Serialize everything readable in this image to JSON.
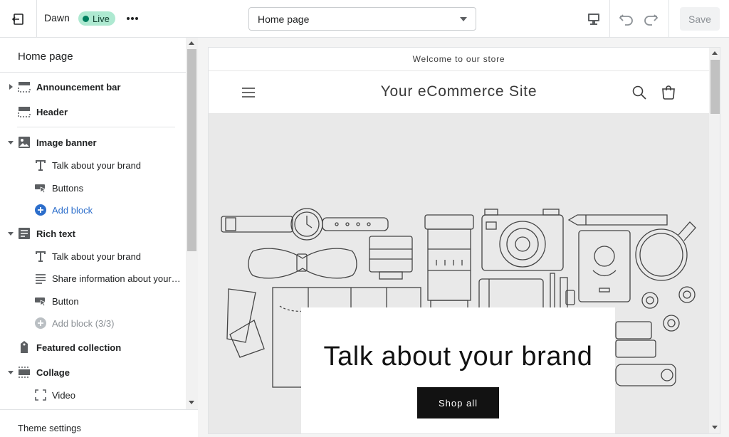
{
  "topbar": {
    "exit_icon": "exit-icon",
    "theme_name": "Dawn",
    "live_badge": "Live",
    "more_icon": "more-horizontal-icon",
    "page_select": "Home page",
    "device_icon": "desktop-icon",
    "undo_icon": "undo-icon",
    "redo_icon": "redo-icon",
    "save_label": "Save"
  },
  "sidebar": {
    "title": "Home page",
    "sections": {
      "announcement_bar": "Announcement bar",
      "header": "Header",
      "image_banner": "Image banner",
      "rich_text": "Rich text",
      "featured_collection": "Featured collection",
      "collage": "Collage"
    },
    "blocks": {
      "banner_text": "Talk about your brand",
      "banner_buttons": "Buttons",
      "banner_add": "Add block",
      "rich_heading": "Talk about your brand",
      "rich_text": "Share information about your brand with your customers",
      "rich_button": "Button",
      "rich_add": "Add block (3/3)",
      "collage_video": "Video"
    },
    "footer": "Theme settings"
  },
  "preview": {
    "announcement": "Welcome to our store",
    "site_title": "Your eCommerce Site",
    "banner_heading": "Talk about your brand",
    "shop_button": "Shop all"
  },
  "colors": {
    "live_bg": "#aee9d1",
    "live_dot": "#007f5f",
    "link": "#2c6ecb",
    "preview_banner_bg": "#e9e9e9",
    "button_dark": "#121212"
  }
}
